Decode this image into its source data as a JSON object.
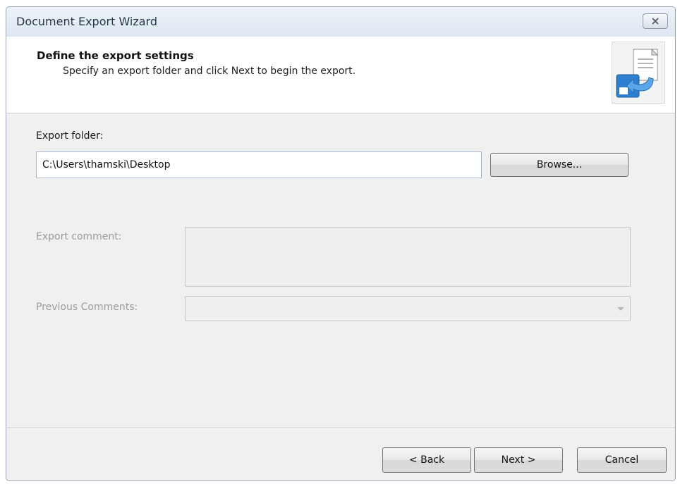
{
  "window": {
    "title": "Document Export Wizard"
  },
  "header": {
    "title": "Define the export settings",
    "subtitle": "Specify an export folder and click Next to begin the export."
  },
  "form": {
    "export_folder_label": "Export folder:",
    "export_folder_value": "C:\\Users\\thamski\\Desktop",
    "browse_label": "Browse...",
    "export_comment_label": "Export comment:",
    "previous_comments_label": "Previous Comments:"
  },
  "footer": {
    "back_label": "< Back",
    "next_label": "Next >",
    "cancel_label": "Cancel"
  },
  "icons": {
    "close": "close-icon",
    "header": "export-document-icon",
    "dropdown": "chevron-down-icon"
  },
  "colors": {
    "header_background": "#ffffff",
    "dialog_background": "#f0f0f0",
    "titlebar": "#e4ecf5",
    "disabled_text": "#9c9c9c"
  }
}
